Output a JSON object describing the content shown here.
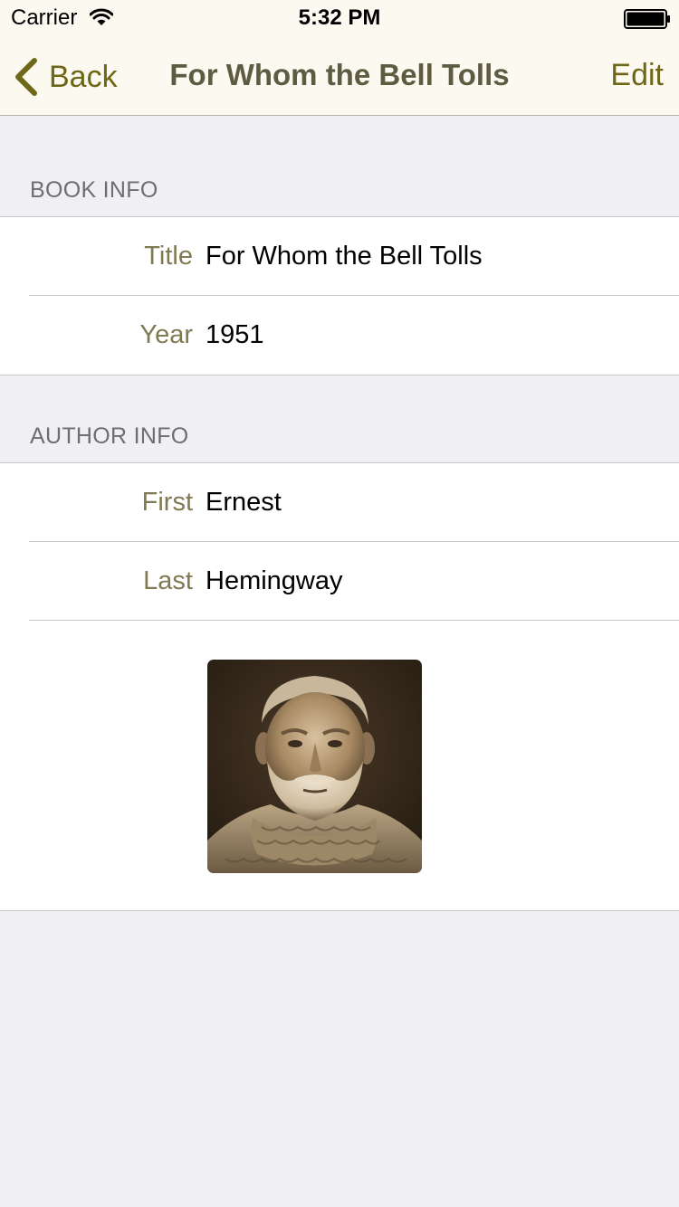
{
  "status_bar": {
    "carrier": "Carrier",
    "time": "5:32 PM",
    "wifi_icon": "wifi-icon",
    "battery_icon": "battery-icon"
  },
  "nav_bar": {
    "back_label": "Back",
    "back_icon": "chevron-left-icon",
    "title": "For Whom the Bell Tolls",
    "edit_label": "Edit",
    "tint_color": "#6e6718",
    "title_color": "#5d5b41"
  },
  "book_info": {
    "header": "BOOK INFO",
    "rows": [
      {
        "label": "Title",
        "value": "For Whom the Bell Tolls"
      },
      {
        "label": "Year",
        "value": "1951"
      }
    ]
  },
  "author_info": {
    "header": "AUTHOR INFO",
    "rows": [
      {
        "label": "First",
        "value": "Ernest"
      },
      {
        "label": "Last",
        "value": "Hemingway"
      }
    ],
    "photo": "author-portrait"
  },
  "colors": {
    "label": "#7f7a52",
    "background": "#efeff4",
    "nav_background": "#fcf9f0"
  }
}
